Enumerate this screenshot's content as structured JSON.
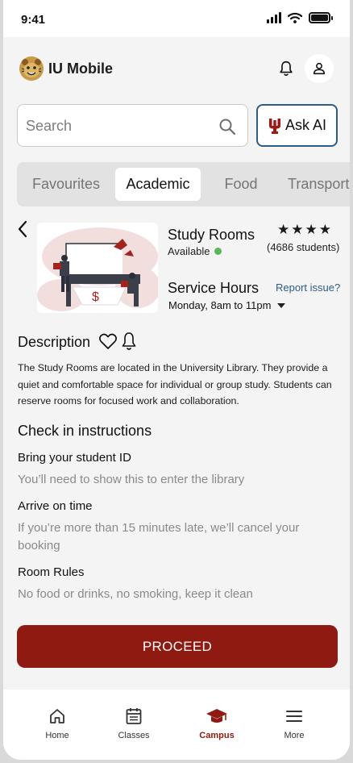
{
  "status_bar": {
    "time": "9:41"
  },
  "header": {
    "app_title": "IU Mobile",
    "icons": [
      "mascot-logo",
      "bell-icon",
      "user-icon"
    ]
  },
  "search": {
    "placeholder": "Search",
    "value": ""
  },
  "ask_ai": {
    "label": "Ask AI"
  },
  "category_tabs": [
    {
      "label": "Favourites",
      "active": false
    },
    {
      "label": "Academic",
      "active": true
    },
    {
      "label": "Food",
      "active": false
    },
    {
      "label": "Transport",
      "active": false
    }
  ],
  "detail": {
    "title": "Study Rooms",
    "availability": "Available",
    "rating_stars": 4,
    "students": "(4686 students)",
    "service_hours_title": "Service Hours",
    "report_link": "Report issue?",
    "hours_value": "Monday, 8am to 11pm"
  },
  "description": {
    "title": "Description",
    "text": "The Study Rooms are located in the University Library. They provide a quiet and comfortable space for individual or group study. Students can reserve rooms for focused work and collaboration."
  },
  "check_in": {
    "title": "Check in instructions",
    "steps": [
      {
        "heading": "Bring your student ID",
        "detail": "You’ll need to show this to enter the library"
      },
      {
        "heading": "Arrive on time",
        "detail": "If you’re more than 15 minutes late, we’ll cancel your booking"
      },
      {
        "heading": "Room Rules",
        "detail": "No food or drinks, no smoking, keep it clean"
      }
    ]
  },
  "proceed_label": "PROCEED",
  "bottom_nav": [
    {
      "label": "Home",
      "icon": "home-icon",
      "active": false
    },
    {
      "label": "Classes",
      "icon": "calendar-icon",
      "active": false
    },
    {
      "label": "Campus",
      "icon": "graduation-cap-icon",
      "active": true
    },
    {
      "label": "More",
      "icon": "menu-icon",
      "active": false
    }
  ],
  "colors": {
    "brand_red": "#8f1a12",
    "accent_blue": "#2d5c86",
    "available_green": "#5bb55b"
  }
}
